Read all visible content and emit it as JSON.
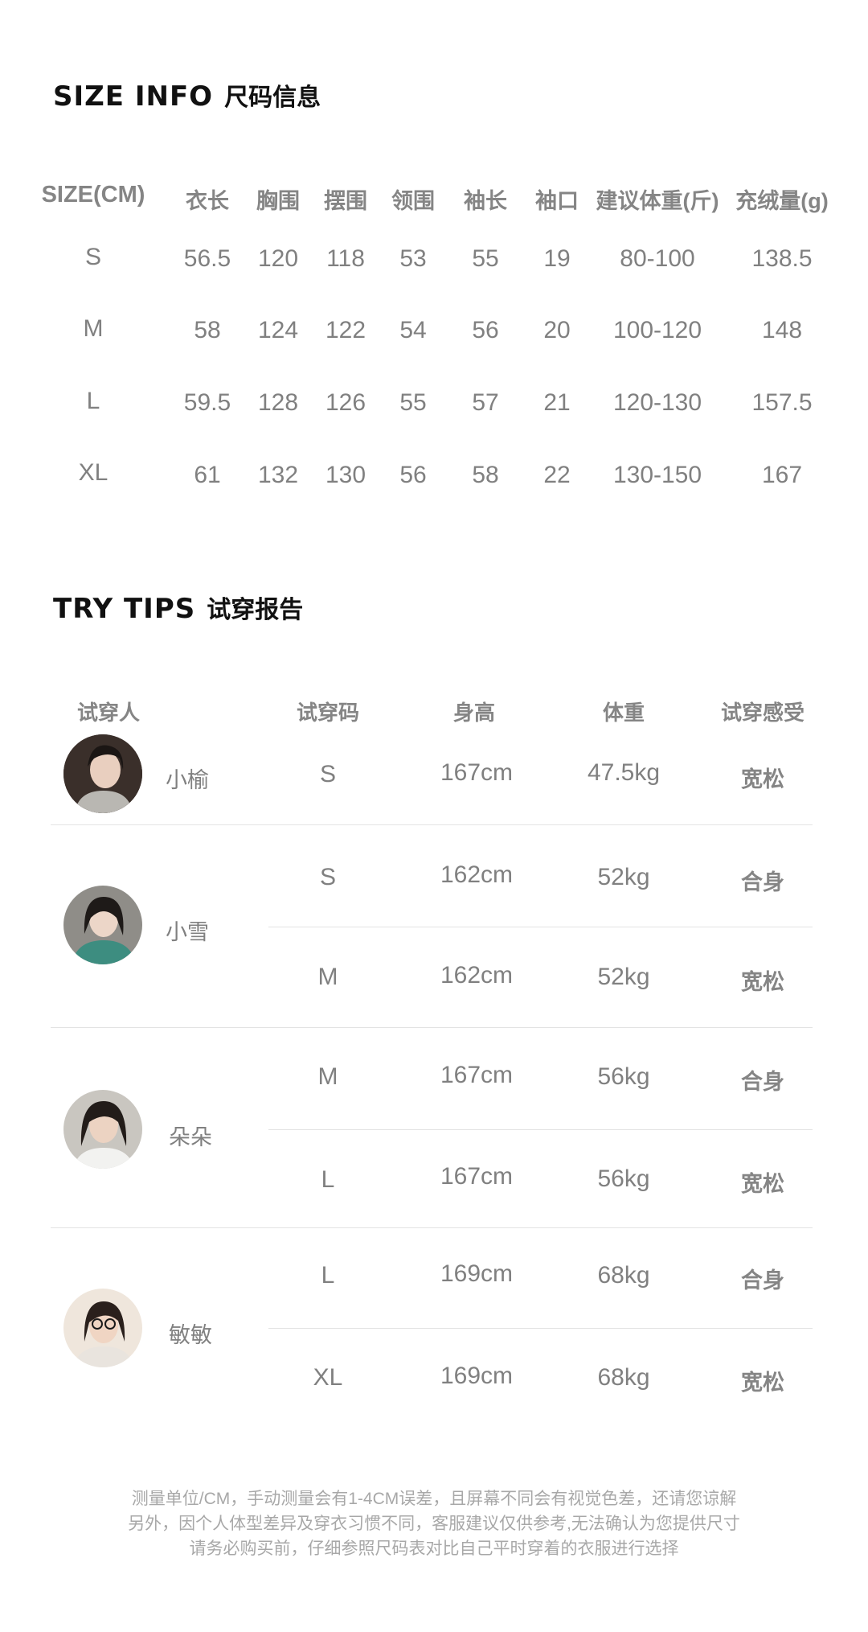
{
  "size_info": {
    "title_en": "SIZE INFO",
    "title_zh": "尺码信息",
    "headers": [
      "SIZE(CM)",
      "衣长",
      "胸围",
      "摆围",
      "领围",
      "袖长",
      "袖口",
      "建议体重(斤)",
      "充绒量(g)"
    ],
    "rows": [
      [
        "S",
        "56.5",
        "120",
        "118",
        "53",
        "55",
        "19",
        "80-100",
        "138.5"
      ],
      [
        "M",
        "58",
        "124",
        "122",
        "54",
        "56",
        "20",
        "100-120",
        "148"
      ],
      [
        "L",
        "59.5",
        "128",
        "126",
        "55",
        "57",
        "21",
        "120-130",
        "157.5"
      ],
      [
        "XL",
        "61",
        "132",
        "130",
        "56",
        "58",
        "22",
        "130-150",
        "167"
      ]
    ]
  },
  "try_tips": {
    "title_en": "TRY TIPS",
    "title_zh": "试穿报告",
    "headers": [
      "试穿人",
      "试穿码",
      "身高",
      "体重",
      "试穿感受"
    ],
    "people": [
      {
        "name": "小榆",
        "rows": [
          [
            "S",
            "167cm",
            "47.5kg",
            "宽松"
          ]
        ]
      },
      {
        "name": "小雪",
        "rows": [
          [
            "S",
            "162cm",
            "52kg",
            "合身"
          ],
          [
            "M",
            "162cm",
            "52kg",
            "宽松"
          ]
        ]
      },
      {
        "name": "朵朵",
        "rows": [
          [
            "M",
            "167cm",
            "56kg",
            "合身"
          ],
          [
            "L",
            "167cm",
            "56kg",
            "宽松"
          ]
        ]
      },
      {
        "name": "敏敏",
        "rows": [
          [
            "L",
            "169cm",
            "68kg",
            "合身"
          ],
          [
            "XL",
            "169cm",
            "68kg",
            "宽松"
          ]
        ]
      }
    ]
  },
  "footer_notes": [
    "测量单位/CM，手动测量会有1-4CM误差，且屏幕不同会有视觉色差，还请您谅解",
    "另外，因个人体型差异及穿衣习惯不同，客服建议仅供参考,无法确认为您提供尺寸",
    "请务必购买前，仔细参照尺码表对比自己平时穿着的衣服进行选择"
  ]
}
